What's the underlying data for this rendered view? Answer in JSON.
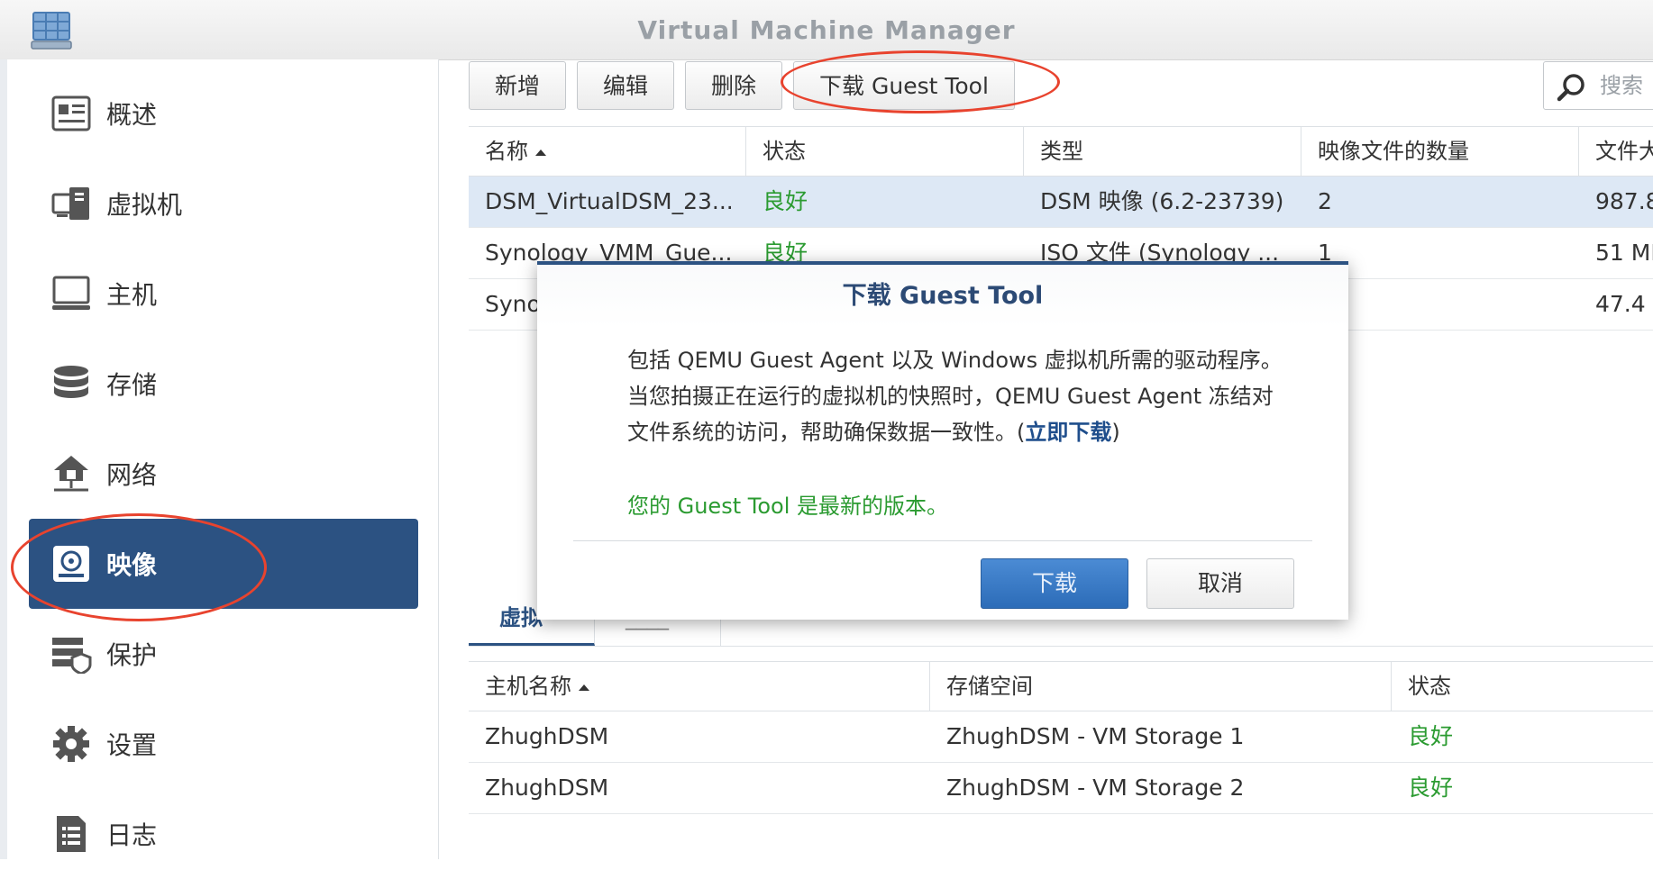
{
  "window": {
    "title": "Virtual Machine Manager"
  },
  "sidebar": {
    "items": [
      {
        "label": "概述",
        "icon": "overview-icon"
      },
      {
        "label": "虚拟机",
        "icon": "virtual-machine-icon"
      },
      {
        "label": "主机",
        "icon": "host-icon"
      },
      {
        "label": "存储",
        "icon": "storage-icon"
      },
      {
        "label": "网络",
        "icon": "network-icon"
      },
      {
        "label": "映像",
        "icon": "image-icon",
        "active": true
      },
      {
        "label": "保护",
        "icon": "protection-icon"
      },
      {
        "label": "设置",
        "icon": "gear-icon"
      },
      {
        "label": "日志",
        "icon": "log-icon"
      }
    ]
  },
  "toolbar": {
    "add": "新增",
    "edit": "编辑",
    "delete": "删除",
    "download_guest_tool": "下载 Guest Tool",
    "search_placeholder": "搜索"
  },
  "images_table": {
    "columns": [
      "名称",
      "状态",
      "类型",
      "映像文件的数量",
      "文件大"
    ],
    "rows": [
      [
        "DSM_VirtualDSM_23...",
        "良好",
        "DSM 映像 (6.2-23739)",
        "2",
        "987.8"
      ],
      [
        "Synology_VMM_Gue...",
        "良好",
        "ISO 文件 (Synology ...",
        "1",
        "51 MI"
      ],
      [
        "Syno",
        "",
        "",
        "",
        "47.4"
      ]
    ]
  },
  "detail_tabs": [
    "虚拟",
    "____"
  ],
  "hosts_table": {
    "columns": [
      "主机名称",
      "存储空间",
      "状态"
    ],
    "rows": [
      [
        "ZhughDSM",
        "ZhughDSM - VM Storage 1",
        "良好"
      ],
      [
        "ZhughDSM",
        "ZhughDSM - VM Storage 2",
        "良好"
      ]
    ]
  },
  "dialog": {
    "title": "下载 Guest Tool",
    "line1": "包括 QEMU Guest Agent 以及 Windows 虚拟机所需的驱动程序。",
    "line2": "当您拍摄正在运行的虚拟机的快照时，QEMU Guest Agent 冻结对",
    "line3_prefix": "文件系统的访问，帮助确保数据一致性。(",
    "link": "立即下载",
    "line3_suffix": ")",
    "status": "您的 Guest Tool 是最新的版本。",
    "download_button": "下载",
    "cancel_button": "取消"
  },
  "colors": {
    "accent": "#2c5282",
    "ok_green": "#2b9b31",
    "annotation_red": "#e8432e",
    "selected_row": "#dde8f5"
  }
}
